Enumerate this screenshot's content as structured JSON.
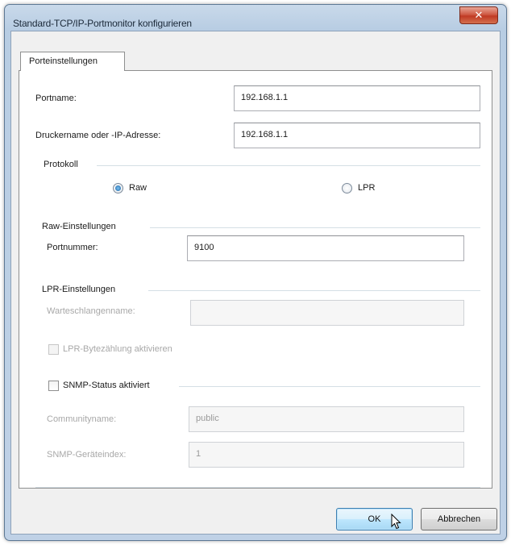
{
  "window": {
    "title": "Standard-TCP/IP-Portmonitor konfigurieren",
    "close_glyph": "✕"
  },
  "tabs": [
    {
      "label": "Porteinstellungen"
    }
  ],
  "port_name": {
    "label": "Portname:",
    "value": "192.168.1.1"
  },
  "printer_address": {
    "label": "Druckername oder -IP-Adresse:",
    "value": "192.168.1.1"
  },
  "protocol": {
    "label": "Protokoll",
    "options": [
      {
        "label": "Raw",
        "selected": true
      },
      {
        "label": "LPR",
        "selected": false
      }
    ]
  },
  "raw_settings": {
    "label": "Raw-Einstellungen",
    "port_number_label": "Portnummer:",
    "port_number_value": "9100"
  },
  "lpr_settings": {
    "label": "LPR-Einstellungen",
    "queue_name_label": "Warteschlangenname:",
    "queue_name_value": "",
    "byte_counting_label": "LPR-Bytezählung aktivieren",
    "byte_counting_checked": false,
    "enabled": false
  },
  "snmp": {
    "label": "SNMP-Status aktiviert",
    "checked": false,
    "community_label": "Communityname:",
    "community_value": "public",
    "device_index_label": "SNMP-Geräteindex:",
    "device_index_value": "1",
    "enabled": false
  },
  "buttons": {
    "ok_label": "OK",
    "cancel_label": "Abbrechen"
  },
  "colors": {
    "title_bar": "#b8cde3",
    "close_button": "#c03a24",
    "default_button": "#bee6fd"
  },
  "icons": {
    "close": "close-icon",
    "cursor": "mouse-cursor-icon"
  }
}
